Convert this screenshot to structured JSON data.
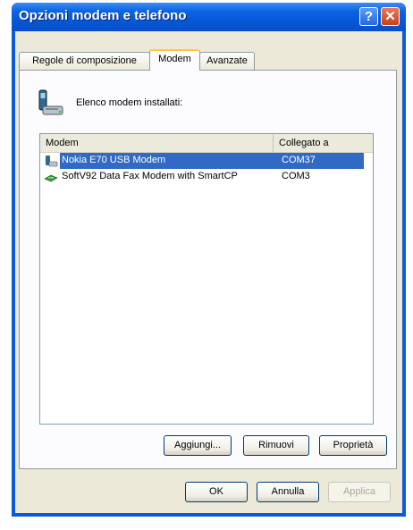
{
  "window": {
    "title": "Opzioni modem e telefono",
    "help_glyph": "?",
    "close_glyph": "✕"
  },
  "tabs": [
    {
      "label": "Regole di composizione"
    },
    {
      "label": "Modem",
      "active": true
    },
    {
      "label": "Avanzate"
    }
  ],
  "panel": {
    "intro_label": "Elenco modem installati:",
    "icon": "phone-modem-icon",
    "columns": [
      "Modem",
      "Collegato a"
    ],
    "rows": [
      {
        "name": "Nokia E70 USB Modem",
        "port": "COM37",
        "icon": "phone-icon",
        "selected": true
      },
      {
        "name": "SoftV92 Data Fax Modem with SmartCP",
        "port": "COM3",
        "icon": "modem-icon",
        "selected": false
      }
    ],
    "buttons": {
      "add": "Aggiungi...",
      "remove": "Rimuovi",
      "properties": "Proprietà"
    }
  },
  "footer": {
    "ok": "OK",
    "cancel": "Annulla",
    "apply": "Applica"
  },
  "colors": {
    "title_bar": "#0a64e4",
    "selection": "#316ac5",
    "dialog_bg": "#ece9d8"
  }
}
